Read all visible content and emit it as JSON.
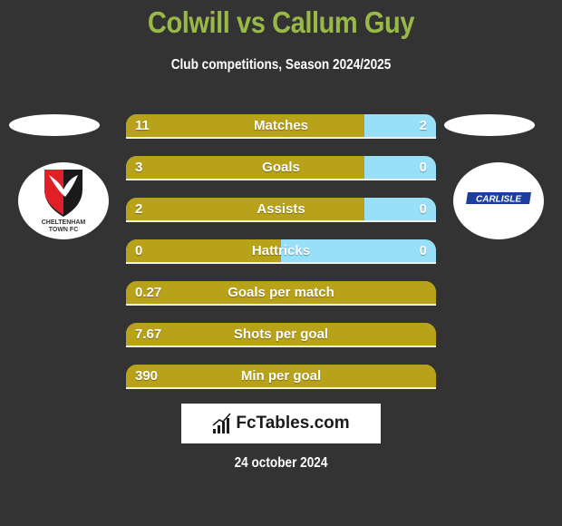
{
  "header": {
    "title": "Colwill vs Callum Guy",
    "subtitle": "Club competitions, Season 2024/2025"
  },
  "teams": {
    "left": {
      "name": "Cheltenham Town FC",
      "logo_line1": "CHELTENHAM",
      "logo_line2": "TOWN FC"
    },
    "right": {
      "name": "Carlisle",
      "logo_text": "CARLISLE"
    }
  },
  "colors": {
    "title": "#99b946",
    "left_bar": "#b8a21a",
    "right_bar": "#98e0f8",
    "background": "#333333"
  },
  "stats": [
    {
      "label": "Matches",
      "left": "11",
      "right": "2",
      "left_share": 0.77
    },
    {
      "label": "Goals",
      "left": "3",
      "right": "0",
      "left_share": 0.77
    },
    {
      "label": "Assists",
      "left": "2",
      "right": "0",
      "left_share": 0.77
    },
    {
      "label": "Hattricks",
      "left": "0",
      "right": "0",
      "left_share": 0.5
    },
    {
      "label": "Goals per match",
      "left": "0.27",
      "right": null,
      "left_share": 1.0
    },
    {
      "label": "Shots per goal",
      "left": "7.67",
      "right": null,
      "left_share": 1.0
    },
    {
      "label": "Min per goal",
      "left": "390",
      "right": null,
      "left_share": 1.0
    }
  ],
  "brand": {
    "name": "FcTables.com",
    "icon": "bar-chart-icon"
  },
  "footer": {
    "date": "24 october 2024"
  }
}
